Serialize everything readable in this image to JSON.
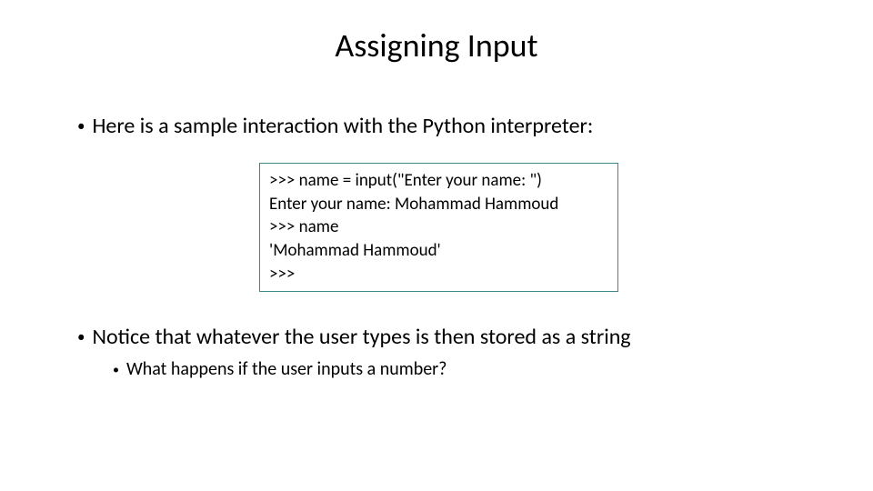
{
  "title": "Assigning Input",
  "bullet1": "Here is a sample interaction with the Python interpreter:",
  "code": {
    "line1": ">>> name = input(\"Enter your name: \")",
    "line2": "Enter your name: Mohammad Hammoud",
    "line3": ">>> name",
    "line4": "'Mohammad Hammoud'",
    "line5": ">>>"
  },
  "bullet2": "Notice that whatever the user types is then stored as a string",
  "bullet3": "What happens if the user inputs a number?"
}
